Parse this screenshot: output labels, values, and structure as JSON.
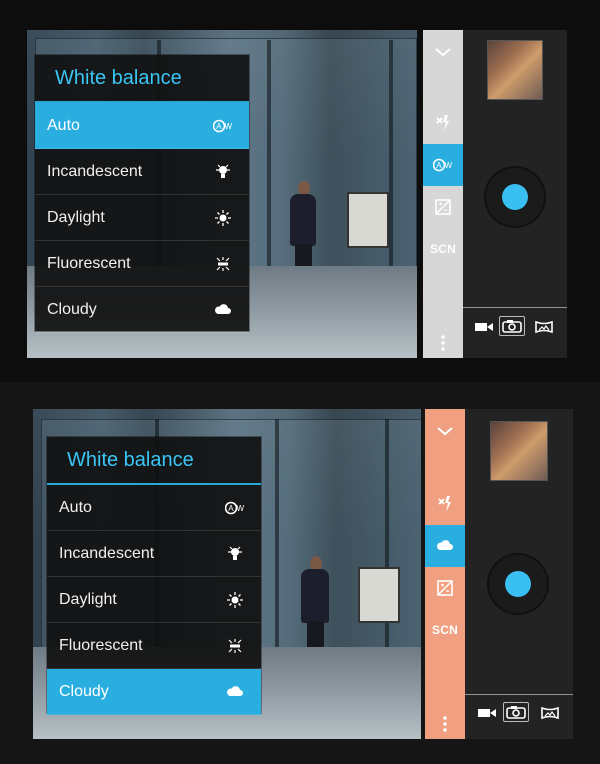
{
  "screens": [
    {
      "white_balance": {
        "title": "White balance",
        "selected": "Auto",
        "items": [
          {
            "label": "Auto",
            "icon": "auto-wb-icon"
          },
          {
            "label": "Incandescent",
            "icon": "incandescent-icon"
          },
          {
            "label": "Daylight",
            "icon": "sun-icon"
          },
          {
            "label": "Fluorescent",
            "icon": "fluorescent-icon"
          },
          {
            "label": "Cloudy",
            "icon": "cloud-icon"
          }
        ]
      },
      "sidebar": {
        "scene_label": "SCN",
        "active_icon": "auto-wb-icon",
        "accent": "#2aaee0",
        "strip_color": "#d7d7d7"
      }
    },
    {
      "white_balance": {
        "title": "White balance",
        "selected": "Cloudy",
        "items": [
          {
            "label": "Auto",
            "icon": "auto-wb-icon"
          },
          {
            "label": "Incandescent",
            "icon": "incandescent-icon"
          },
          {
            "label": "Daylight",
            "icon": "sun-icon"
          },
          {
            "label": "Fluorescent",
            "icon": "fluorescent-icon"
          },
          {
            "label": "Cloudy",
            "icon": "cloud-icon"
          }
        ]
      },
      "sidebar": {
        "scene_label": "SCN",
        "active_icon": "cloud-icon",
        "accent": "#2aaee0",
        "strip_color": "#f0a080"
      }
    }
  ]
}
